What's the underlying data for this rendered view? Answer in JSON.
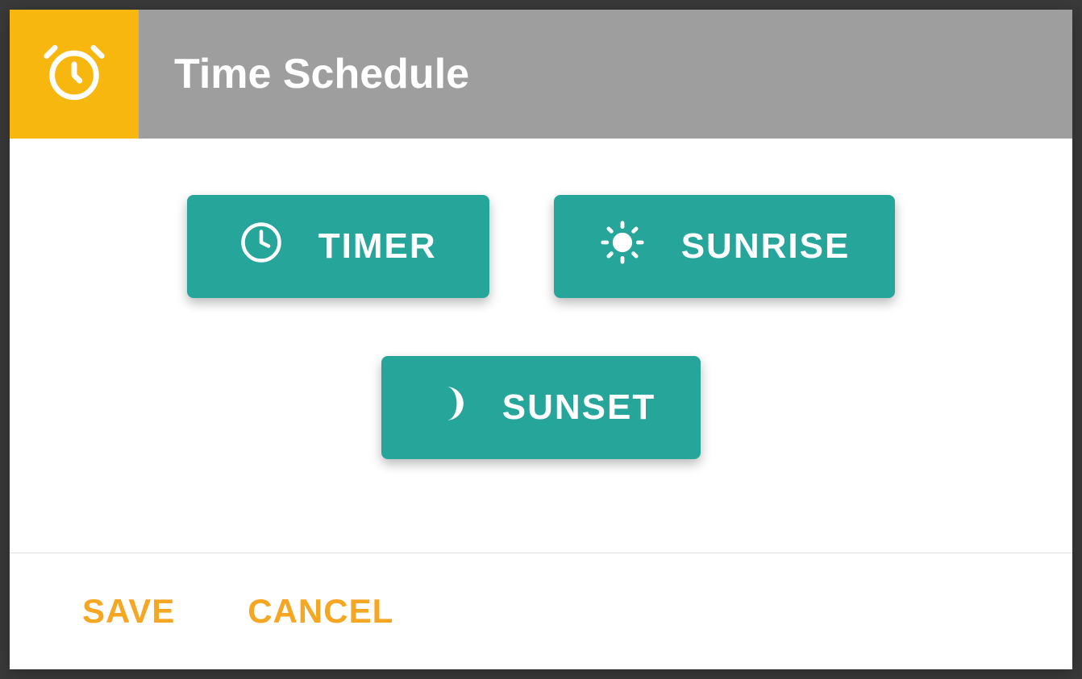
{
  "header": {
    "title": "Time Schedule"
  },
  "options": {
    "timer": "TIMER",
    "sunrise": "SUNRISE",
    "sunset": "SUNSET"
  },
  "footer": {
    "save": "SAVE",
    "cancel": "CANCEL"
  },
  "colors": {
    "accent": "#f8b70f",
    "primary": "#26a69a",
    "header_bg": "#9e9e9e",
    "action_text": "#f5a623"
  }
}
